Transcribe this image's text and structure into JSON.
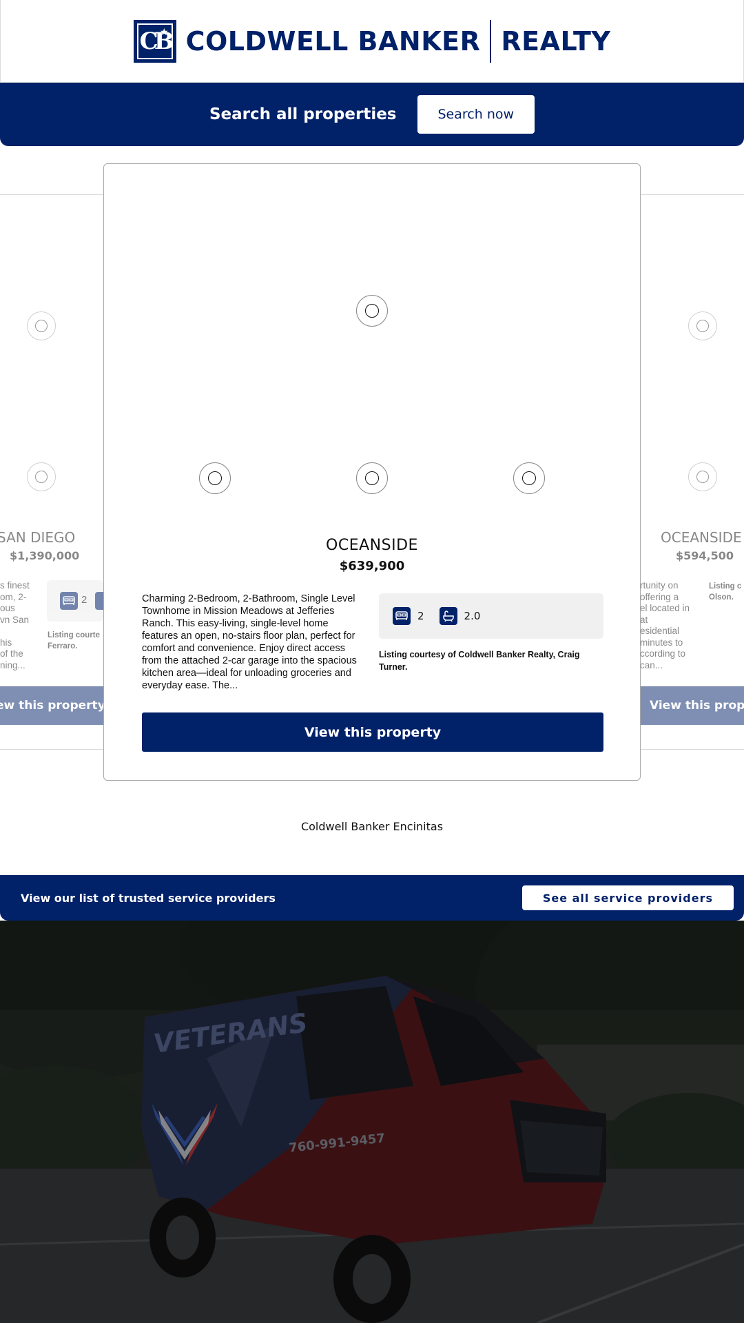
{
  "brand": {
    "logo_monogram": "CB",
    "logo_name": "COLDWELL BANKER",
    "logo_suffix": "REALTY",
    "primary_color": "#012169"
  },
  "search_banner": {
    "label": "Search all properties",
    "button": "Search now"
  },
  "listings": [
    {
      "city": "SAN DIEGO",
      "price": "$1,390,000",
      "desc_fragments": [
        "s finest",
        "om, 2-",
        "ous",
        "vn San",
        "",
        "his",
        "of the",
        "ning..."
      ],
      "beds": "2",
      "courtesy_fragments": [
        "Listing courte",
        "Ferraro."
      ],
      "button": "View this property",
      "button_fragment": "ew this property"
    },
    {
      "city": "OCEANSIDE",
      "price": "$639,900",
      "description": "Charming 2-Bedroom, 2-Bathroom, Single Level Townhome in Mission Meadows at Jefferies Ranch. This easy-living, single-level home features an open, no-stairs floor plan, perfect for comfort and convenience. Enjoy direct access from the attached 2-car garage into the spacious kitchen area—ideal for unloading groceries and everyday ease. The...",
      "beds": "2",
      "baths": "2.0",
      "courtesy": "Listing courtesy of Coldwell Banker Realty, Craig Turner.",
      "button": "View this property"
    },
    {
      "city": "OCEANSIDE",
      "city_fragment": "OCEANSIDE",
      "price": "$594,500",
      "desc_fragments": [
        "rtunity on",
        "offering a",
        "el located in",
        "at",
        "esidential",
        "minutes to",
        "ccording to",
        " can..."
      ],
      "courtesy_fragments": [
        "Listing c",
        "Olson."
      ],
      "button": "View this property",
      "button_fragment": "View this proper"
    }
  ],
  "office": {
    "name": "Coldwell Banker Encinitas"
  },
  "service_banner": {
    "label": "View our list of trusted service providers",
    "button": "See all service providers"
  },
  "hero": {
    "van_brand": "VETERANS",
    "van_phone": "760-991-9457"
  },
  "icons": [
    "bed-icon",
    "bath-icon",
    "star-icon",
    "radio-icon"
  ]
}
